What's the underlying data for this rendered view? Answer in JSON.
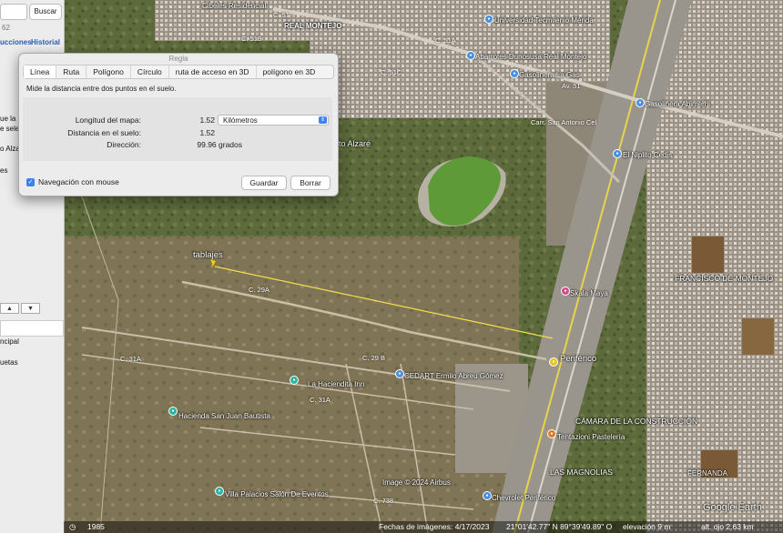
{
  "sidebar": {
    "search_button": "Buscar",
    "fragment_1": "62",
    "link_instrucciones": "ucciones",
    "link_historial": "Historial",
    "fragment_ue": "ue la",
    "fragment_sele": "e sele",
    "fragment_alza": "o Alza",
    "fragment_es": "es",
    "fragment_ncipal": "ncipal",
    "fragment_uetas": "uetas",
    "arrow_up": "▲",
    "arrow_down": "▼"
  },
  "dialog": {
    "title": "Regla",
    "tabs": [
      "Línea",
      "Ruta",
      "Polígono",
      "Círculo",
      "ruta de acceso en 3D",
      "polígono en 3D"
    ],
    "description": "Mide la distancia entre dos puntos en el suelo.",
    "map_length_label": "Longitud del mapa:",
    "map_length_value": "1.52",
    "unit": "Kilómetros",
    "ground_length_label": "Distancia en el suelo:",
    "ground_length_value": "1.52",
    "direction_label": "Dirección:",
    "direction_value": "99.96 grados",
    "mouse_nav_label": "Navegación con mouse",
    "save_button": "Guardar",
    "clear_button": "Borrar"
  },
  "map": {
    "placemark_label": "tablajes",
    "labels": {
      "cdmx_residencial": "Cibeles Residencial",
      "real_montejo": "REAL MONTEJO",
      "universidad": "Universidad Tecmilenio Mérida",
      "abarrotes": "Abarrotes Dunosusa Real Montejo",
      "gasolinera_gas": "Gasolinera La Gas",
      "gasolinera_abimerhi": "Gasolinera Abimerhi",
      "nipito": "El Niplito Cedis",
      "sto_alzare": "to Alzaré",
      "francisco": "FRANCISCO DE MONTEJO",
      "skala": "Skala Maya",
      "periferico": "Periférico",
      "cedart": "CEDART Ermilo Abreu Gómez",
      "hacendita": "La Haciendita Inn",
      "hacienda": "Hacienda San Juan Bautista",
      "camara": "CÁMARA DE LA CONSTRUCCIÓN",
      "tentaziones": "Tentazioni Pastelería",
      "magnolias": "LAS MAGNOLIAS",
      "fernanda": "FERNANDA",
      "villa": "Villa Palacios Salón De Eventos",
      "chevrolet": "Chevrolet Periférico",
      "image_credit": "Image © 2024 Airbus",
      "google_earth": "Google Earth"
    },
    "roads": {
      "c51": "C. 51",
      "c51a": "C. 51A",
      "c51c": "C. 51C",
      "c29a": "C. 29A",
      "c31a": "C. 31A",
      "c31a_2": "C. 31A",
      "c29b": "C. 29 B",
      "c738": "C. 738",
      "av51": "Av. 51",
      "c518": "C. 518",
      "san_antonio": "Carr. San Antonio Cel"
    }
  },
  "status_bar": {
    "year": "1985",
    "image_date": "Fechas de imágenes: 4/17/2023",
    "coords": "21°01'42.77\" N  89°39'49.89\" O",
    "elevation": "elevación  9 m",
    "eye_alt": "alt. ojo  2.63 km"
  }
}
